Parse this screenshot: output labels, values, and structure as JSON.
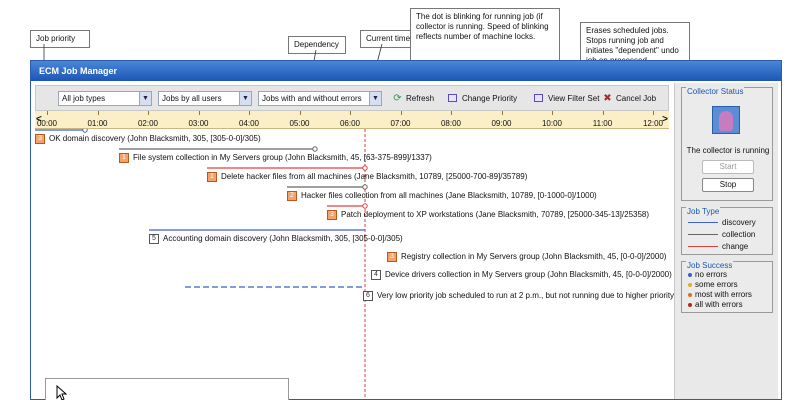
{
  "callouts": {
    "job_priority": "Job priority",
    "dependency": "Dependency",
    "current_time": "Current time",
    "running_dot": "The dot is blinking for running job (if collector is running. Speed of blinking reflects number of machine locks.",
    "erases": "Erases scheduled jobs. Stops running job and initiates \"dependent\" undo job on processed machines."
  },
  "window": {
    "title": "ECM Job Manager"
  },
  "toolbar": {
    "filter_type": "All job types",
    "filter_user": "Jobs by all users",
    "filter_errors": "Jobs with and without errors",
    "refresh": "Refresh",
    "change_priority": "Change Priority",
    "view_filter_set": "View Filter Set",
    "cancel_job": "Cancel Job"
  },
  "ruler": {
    "ticks": [
      "00:00",
      "01:00",
      "02:00",
      "03:00",
      "04:00",
      "05:00",
      "06:00",
      "07:00",
      "08:00",
      "09:00",
      "10:00",
      "11:00",
      "12:00"
    ]
  },
  "jobs": [
    {
      "priority": "3",
      "label": "OK domain discovery (John Blacksmith, 305, [305-0-0]/305)",
      "status": "running"
    },
    {
      "priority": "1",
      "label": "File system collection in My Servers group (John Blacksmith, 45, [63-375-899]/1337)",
      "status": "running"
    },
    {
      "priority": "1",
      "label": "Delete hacker files from all machines (Jane Blacksmith, 10789, [25000-700-89]/35789)",
      "status": "running"
    },
    {
      "priority": "2",
      "label": "Hacker files collection from all machines (Jane Blacksmith, 10789, [0-1000-0]/1000)",
      "status": "running"
    },
    {
      "priority": "3",
      "label": "Patch deployment to XP workstations (Jane Blacksmith, 70789, [25000-345-13]/25358)",
      "status": "running"
    },
    {
      "priority": "5",
      "label": "Accounting domain discovery (John Blacksmith, 305, [305-0-0]/305)",
      "status": "waiting"
    },
    {
      "priority": "3",
      "label": "Registry collection in My Servers group (John Blacksmith, 45, [0-0-0]/2000)",
      "status": "running"
    },
    {
      "priority": "4",
      "label": "Device drivers collection in My Servers group (John Blacksmith, 45, [0-0-0]/2000)",
      "status": "waiting"
    },
    {
      "priority": "6",
      "label": "Very low priority job scheduled to run at 2 p.m., but not running due to higher priority jobs",
      "status": "waiting"
    }
  ],
  "side": {
    "collector_title": "Collector Status",
    "collector_status": "The collector is running",
    "start": "Start",
    "stop": "Stop",
    "job_type_title": "Job Type",
    "job_types": [
      "discovery",
      "collection",
      "change"
    ],
    "job_success_title": "Job Success",
    "job_success": [
      "no errors",
      "some errors",
      "most with errors",
      "all with errors"
    ]
  },
  "colors": {
    "discovery": "#3a5fd0",
    "collection": "#666666",
    "change": "#e04040",
    "no_errors": "#3a5fd0",
    "some_errors": "#e0b020",
    "most_errors": "#e07020",
    "all_errors": "#c02020"
  }
}
